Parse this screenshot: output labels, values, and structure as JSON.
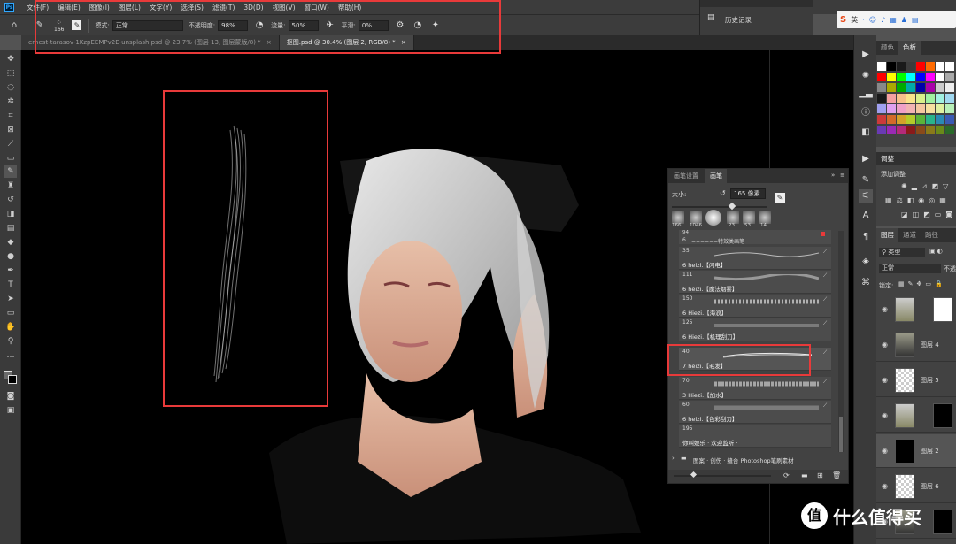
{
  "app": {
    "logo": "Ps"
  },
  "menu": [
    "文件(F)",
    "编辑(E)",
    "图像(I)",
    "图层(L)",
    "文字(Y)",
    "选择(S)",
    "滤镜(T)",
    "3D(D)",
    "视图(V)",
    "窗口(W)",
    "帮助(H)"
  ],
  "options": {
    "brush_size": "166",
    "mode_label": "模式:",
    "mode_value": "正常",
    "opacity_label": "不透明度:",
    "opacity_value": "98%",
    "flow_label": "流量:",
    "flow_value": "50%",
    "smooth_label": "平滑:",
    "smooth_value": "0%"
  },
  "history": {
    "label": "历史记录"
  },
  "tabs": [
    {
      "label": "ernest-tarasov-1KzpEEMPv2E-unsplash.psd @ 23.7% (图层 13, 图层蒙版/8) *",
      "close": "×"
    },
    {
      "label": "抠图.psd @ 30.4% (图层 2, RGB/8) *",
      "close": "×"
    }
  ],
  "swatches_panel": {
    "tab1": "颜色",
    "tab2": "色板"
  },
  "adjust_panel": {
    "title": "调整",
    "subtitle": "添加调整"
  },
  "layers_panel": {
    "tabs": [
      "图层",
      "通道",
      "路径"
    ],
    "filter_label": "类型",
    "blend_mode": "正常",
    "opacity_short": "不透",
    "lock_label": "锁定:",
    "layers": [
      {
        "name": ""
      },
      {
        "name": "图层 4"
      },
      {
        "name": "图层 5"
      },
      {
        "name": ""
      },
      {
        "name": "图层 2"
      },
      {
        "name": "图层 6"
      },
      {
        "name": ""
      }
    ]
  },
  "brush_panel": {
    "tab_settings": "画笔设置",
    "tab_brushes": "画笔",
    "size_label": "大小:",
    "size_value": "165 像素",
    "preset_sizes": [
      "166",
      "1046",
      "",
      "23",
      "53",
      "14"
    ],
    "group_header_num": "6",
    "group_header": "======特效类画笔",
    "brushes": [
      {
        "size": "35",
        "name": "6 heizi.【闪电】"
      },
      {
        "size": "111",
        "name": "6 heizi.【魔法烟雾】"
      },
      {
        "size": "150",
        "name": "6 Hiezi.【海浪】"
      },
      {
        "size": "125",
        "name": "6 Hiezi.【机理刮刀】"
      },
      {
        "size": "40",
        "name": "7 heizi.【毛发】"
      },
      {
        "size": "70",
        "name": "3 Hiezi.【加水】"
      },
      {
        "size": "60",
        "name": "6 heizi.【色彩刮刀】"
      },
      {
        "size": "195",
        "name": "你叫娱乐 · 欢迎监听 ·"
      }
    ],
    "folder_label": "图案 · 创伤 · 缝合 Photoshop笔刷素材",
    "top_size": "94"
  },
  "watermark": {
    "text": "什么值得买",
    "logo": "值"
  },
  "colors": {
    "red_box": "#e83a3a",
    "panel_bg": "#424242",
    "canvas": "#000000"
  }
}
